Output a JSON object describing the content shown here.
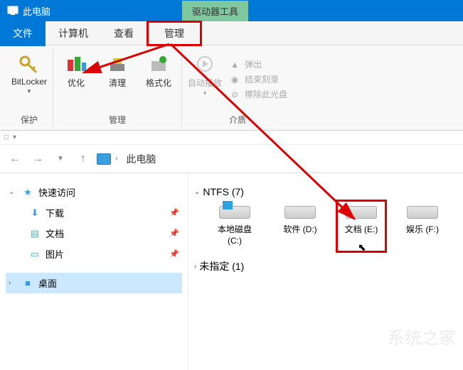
{
  "window": {
    "title": "此电脑",
    "tool_tab": "驱动器工具"
  },
  "menu": {
    "file": "文件",
    "computer": "计算机",
    "view": "查看",
    "manage": "管理"
  },
  "ribbon": {
    "bitlocker": "BitLocker",
    "optimize": "优化",
    "cleanup": "清理",
    "format": "格式化",
    "autoplay": "自动播放",
    "eject": "弹出",
    "finish_burn": "结束刻录",
    "erase_disc": "擦除此光盘",
    "group_protect": "保护",
    "group_manage": "管理",
    "group_media": "介质"
  },
  "nav": {
    "location": "此电脑"
  },
  "sidebar": {
    "quick_access": "快速访问",
    "downloads": "下载",
    "documents": "文档",
    "pictures": "图片",
    "desktop": "桌面"
  },
  "main": {
    "section_ntfs": "NTFS (7)",
    "section_unspec": "未指定 (1)",
    "drives": [
      {
        "label": "本地磁盘 (C:)"
      },
      {
        "label": "软件 (D:)"
      },
      {
        "label": "文档 (E:)"
      },
      {
        "label": "娱乐 (F:)"
      }
    ]
  },
  "watermark": "系统之家"
}
